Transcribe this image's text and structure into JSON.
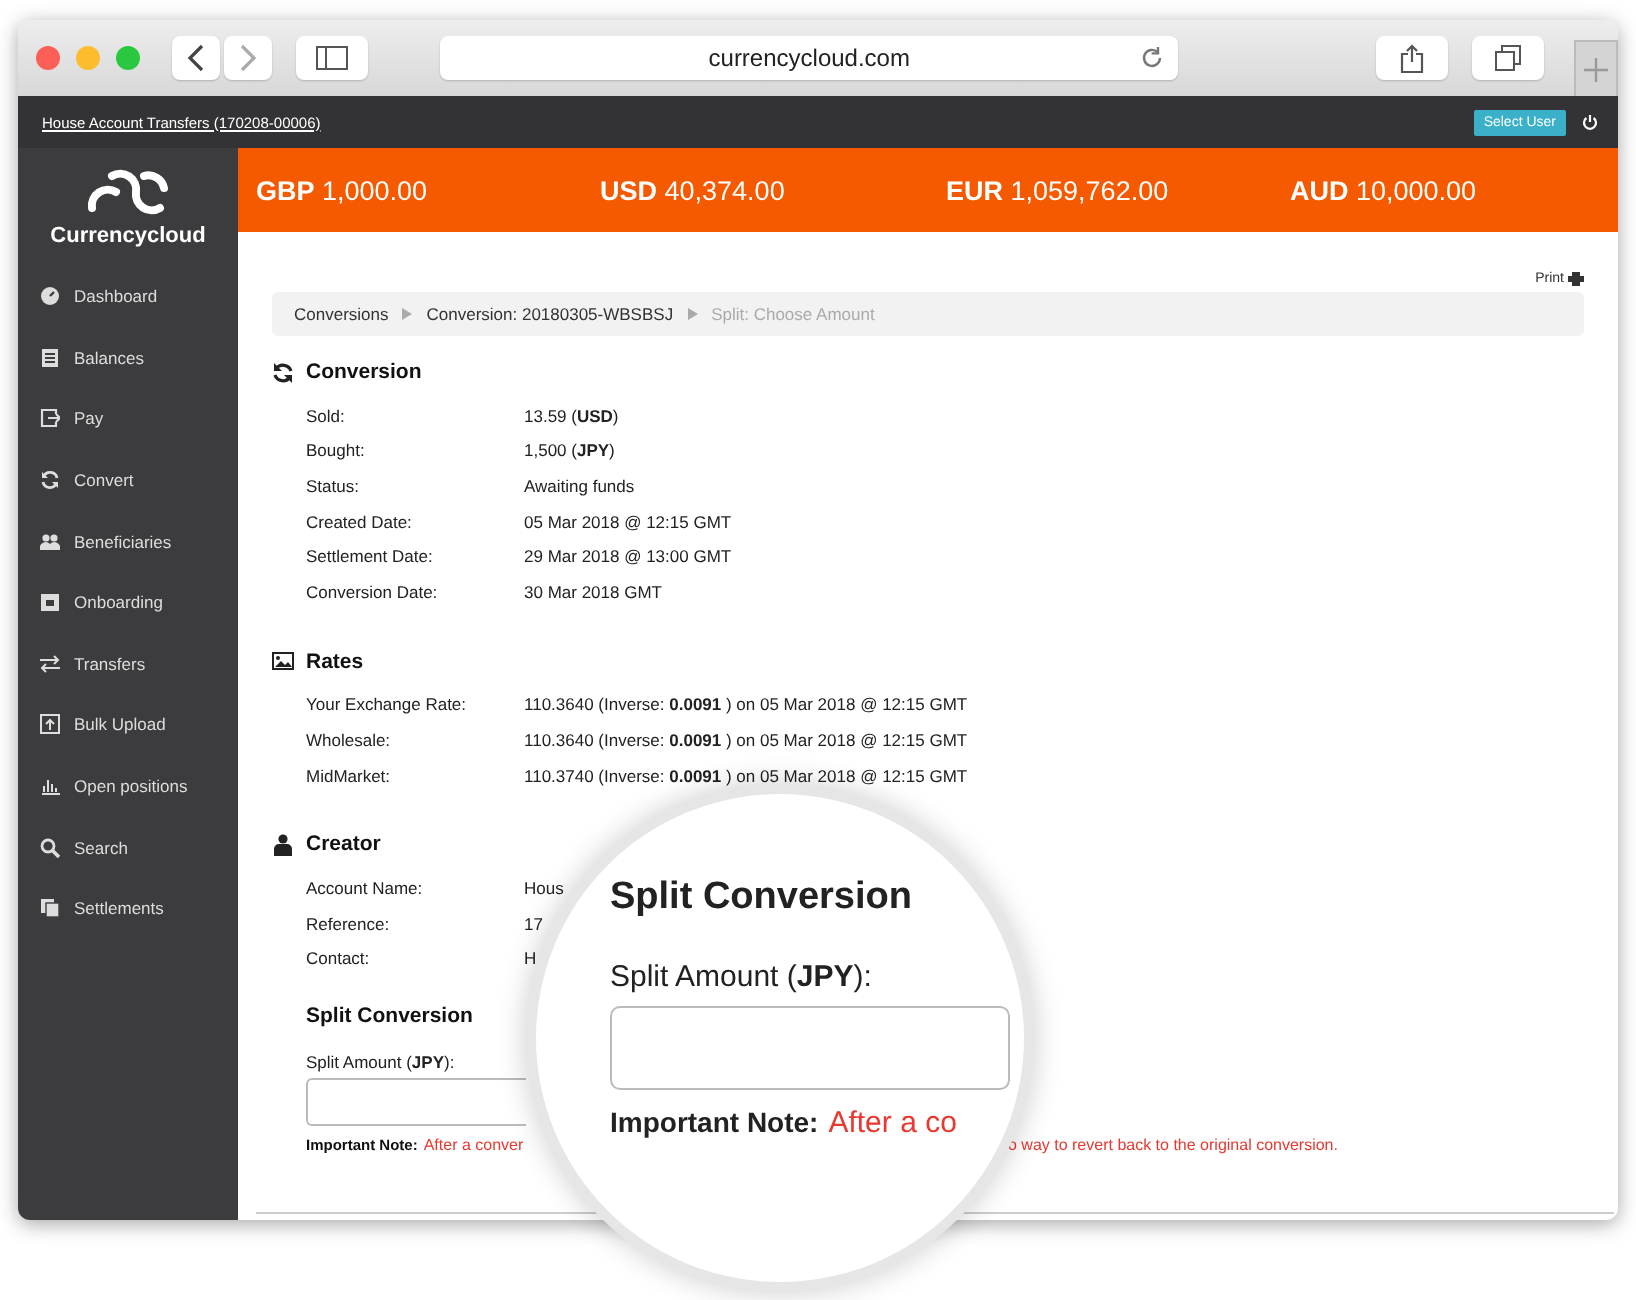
{
  "browser": {
    "url": "currencycloud.com"
  },
  "top_bar": {
    "account_link": "House Account Transfers (170208-00006)",
    "select_user_button": "Select User"
  },
  "sidebar": {
    "logo": "Currencycloud",
    "items": [
      {
        "label": "Dashboard"
      },
      {
        "label": "Balances"
      },
      {
        "label": "Pay"
      },
      {
        "label": "Convert"
      },
      {
        "label": "Beneficiaries"
      },
      {
        "label": "Onboarding"
      },
      {
        "label": "Transfers"
      },
      {
        "label": "Bulk Upload"
      },
      {
        "label": "Open positions"
      },
      {
        "label": "Search"
      },
      {
        "label": "Settlements"
      }
    ]
  },
  "balances": [
    {
      "currency": "GBP",
      "amount": "1,000.00"
    },
    {
      "currency": "USD",
      "amount": "40,374.00"
    },
    {
      "currency": "EUR",
      "amount": "1,059,762.00"
    },
    {
      "currency": "AUD",
      "amount": "10,000.00"
    }
  ],
  "print_link": "Print",
  "breadcrumb": [
    {
      "label": "Conversions",
      "current": false
    },
    {
      "label": "Conversion: 20180305-WBSBSJ",
      "current": false
    },
    {
      "label": "Split: Choose Amount",
      "current": true
    }
  ],
  "sections": [
    {
      "title": "Conversion",
      "rows": [
        {
          "label": "Sold:",
          "value": "13.59 (**USD**)"
        },
        {
          "label": "Bought:",
          "value": "1,500 (**JPY**)"
        },
        {
          "label": "Status:",
          "value": "Awaiting funds"
        },
        {
          "label": "Created Date:",
          "value": "05 Mar 2018 @ 12:15 GMT"
        },
        {
          "label": "Settlement Date:",
          "value": "29 Mar 2018 @ 13:00 GMT"
        },
        {
          "label": "Conversion Date:",
          "value": "30 Mar 2018 GMT"
        }
      ]
    },
    {
      "title": "Rates",
      "rows": [
        {
          "label": "Your Exchange Rate:",
          "value": "110.3640 (Inverse: **0.0091** ) on 05 Mar 2018 @ 12:15 GMT"
        },
        {
          "label": "Wholesale:",
          "value": "110.3640 (Inverse: **0.0091** ) on 05 Mar 2018 @ 12:15 GMT"
        },
        {
          "label": "MidMarket:",
          "value": "110.3740 (Inverse: **0.0091** ) on 05 Mar 2018 @ 12:15 GMT"
        }
      ]
    },
    {
      "title": "Creator",
      "rows": [
        {
          "label": "Account Name:",
          "value": "Hous"
        },
        {
          "label": "Reference:",
          "value": "17"
        },
        {
          "label": "Contact:",
          "value": "H"
        }
      ]
    }
  ],
  "split": {
    "title": "Split Conversion",
    "field_label": "Split Amount (**JPY**):",
    "note_label": "Important Note:",
    "note_parts": [
      "After a conver",
      "o way to revert back to the original conversion."
    ]
  },
  "magnifier": {
    "title": "Split Conversion",
    "field_label": "Split Amount (**JPY**):",
    "note_label": "Important Note:",
    "note_text": "After a co"
  }
}
